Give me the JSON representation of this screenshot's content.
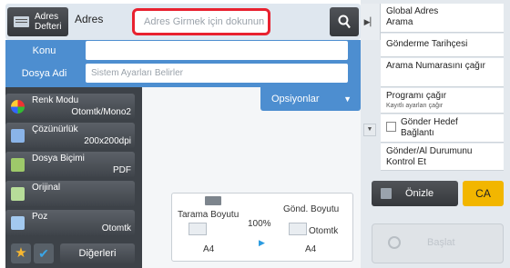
{
  "topbar": {
    "address_book_label": "Adres Defteri",
    "address_label": "Adres",
    "address_placeholder": "Adres Girmek için dokunun"
  },
  "form": {
    "subject_label": "Konu",
    "subject_value": "",
    "filename_label": "Dosya Adi",
    "filename_placeholder": "Sistem Ayarları Belirler"
  },
  "settings": [
    {
      "name": "Renk Modu",
      "value": "Otomtk/Mono2",
      "icon": "color-mode-icon"
    },
    {
      "name": "Çözünürlük",
      "value": "200x200dpi",
      "icon": "resolution-icon"
    },
    {
      "name": "Dosya Biçimi",
      "value": "PDF",
      "icon": "file-format-icon"
    },
    {
      "name": "Orijinal",
      "value": "",
      "icon": "original-icon"
    },
    {
      "name": "Poz",
      "value": "Otomtk",
      "icon": "exposure-icon"
    }
  ],
  "bottom_left": {
    "favorite_icon": "star-icon",
    "check_icon": "check-icon",
    "others_label": "Diğerleri"
  },
  "options_label": "Opsiyonlar",
  "preview_box": {
    "scan_size_label": "Tarama Boyutu",
    "scan_size_value": "A4",
    "ratio": "100%",
    "send_size_label": "Gönd. Boyutu",
    "send_size_mode": "Otomtk",
    "send_size_value": "A4"
  },
  "right_panel": {
    "items": [
      {
        "label": "Global Adres Arama",
        "sub": ""
      },
      {
        "label": "Gönderme Tarihçesi",
        "sub": ""
      },
      {
        "label": "Arama Numarasını çağır",
        "sub": ""
      },
      {
        "label": "Programı çağır",
        "sub": "Kayıtlı ayarları çağır"
      },
      {
        "label": "Gönder Hedef Bağlantı",
        "sub": ""
      },
      {
        "label": "Gönder/Al Durumunu Kontrol Et",
        "sub": ""
      }
    ],
    "preview_label": "Önizle",
    "ca_label": "CA",
    "start_label": "Başlat"
  },
  "colors": {
    "accent_blue": "#4d8ed0",
    "highlight_red": "#e8212f",
    "ca_yellow": "#f2b600",
    "dark_button": "#3f444a"
  }
}
